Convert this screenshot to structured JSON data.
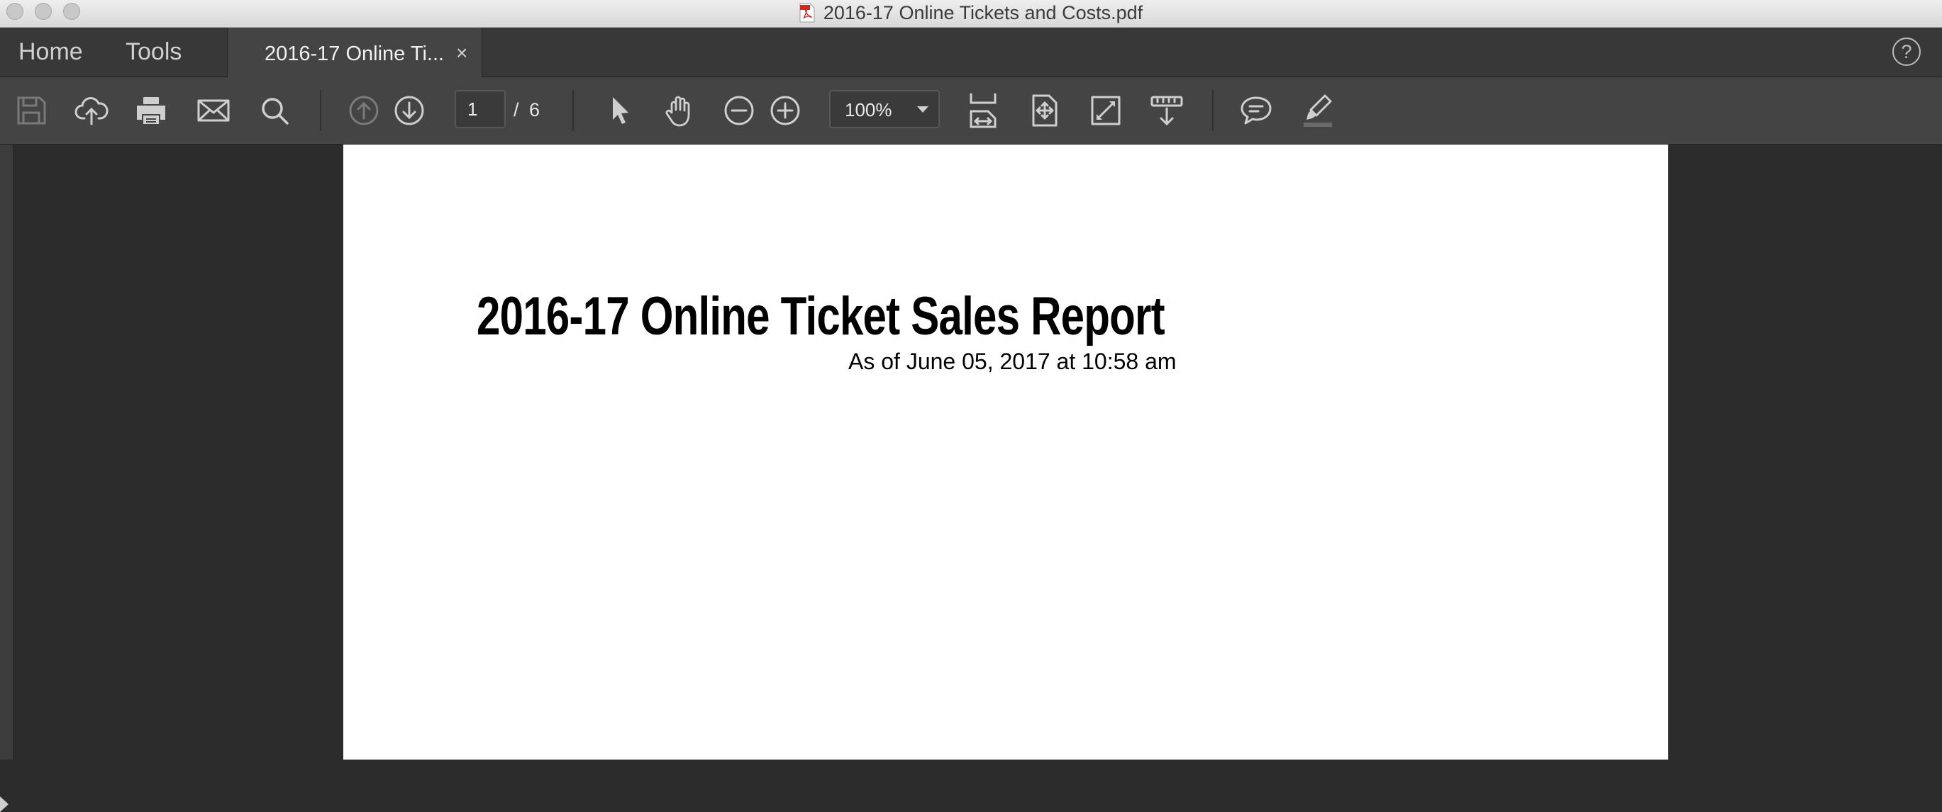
{
  "window": {
    "title": "2016-17 Online Tickets and Costs.pdf"
  },
  "tabbar": {
    "home": "Home",
    "tools": "Tools",
    "document_tab": "2016-17 Online Ti...",
    "close_glyph": "×",
    "help_glyph": "?"
  },
  "toolbar": {
    "icons": [
      "save-icon",
      "upload-cloud-icon",
      "print-icon",
      "email-icon",
      "search-icon",
      "prev-page-icon",
      "next-page-icon",
      "select-arrow-icon",
      "hand-icon",
      "zoom-out-icon",
      "zoom-in-icon",
      "fit-width-icon",
      "fit-page-icon",
      "full-screen-icon",
      "scroll-mode-icon",
      "comment-icon",
      "highlight-icon"
    ],
    "page_current": "1",
    "page_separator": "/",
    "page_total": "6",
    "zoom": "100%"
  },
  "document": {
    "title": "2016-17 Online Ticket Sales Report",
    "subtitle": "As of June 05, 2017 at 10:58 am"
  },
  "colors": {
    "toolbar_bg": "#444444",
    "tabbar_bg": "#383838",
    "workspace_bg": "#2c2c2c",
    "icon_color": "#cfcfcf"
  }
}
